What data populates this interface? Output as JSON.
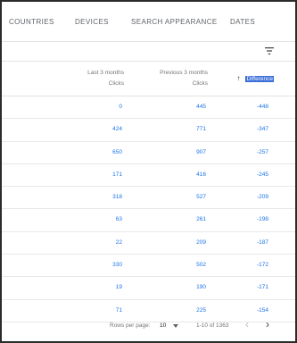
{
  "tabs": [
    {
      "label": "COUNTRIES"
    },
    {
      "label": "DEVICES"
    },
    {
      "label": "SEARCH APPEARANCE"
    },
    {
      "label": "DATES"
    }
  ],
  "filter": {
    "icon": "filter-icon"
  },
  "table": {
    "headers": {
      "col1": {
        "line1": "Last 3 months",
        "line2": "Clicks"
      },
      "col2": {
        "line1": "Previous 3 months",
        "line2": "Clicks"
      },
      "col3": {
        "label": "Difference",
        "sort_icon": "arrow-up-icon",
        "sorted": "ascending"
      }
    },
    "rows": [
      {
        "last": "0",
        "previous": "445",
        "difference": "-448"
      },
      {
        "last": "424",
        "previous": "771",
        "difference": "-347"
      },
      {
        "last": "650",
        "previous": "907",
        "difference": "-257"
      },
      {
        "last": "171",
        "previous": "416",
        "difference": "-245"
      },
      {
        "last": "318",
        "previous": "527",
        "difference": "-209"
      },
      {
        "last": "63",
        "previous": "261",
        "difference": "-198"
      },
      {
        "last": "22",
        "previous": "209",
        "difference": "-187"
      },
      {
        "last": "330",
        "previous": "502",
        "difference": "-172"
      },
      {
        "last": "19",
        "previous": "190",
        "difference": "-171"
      },
      {
        "last": "71",
        "previous": "225",
        "difference": "-154"
      }
    ]
  },
  "pagination": {
    "rows_per_page_label": "Rows per page:",
    "rows_per_page_value": "10",
    "range": "1-10 of 1363"
  },
  "colors": {
    "link_blue": "#1a73e8",
    "highlight": "#3c6fd8"
  }
}
